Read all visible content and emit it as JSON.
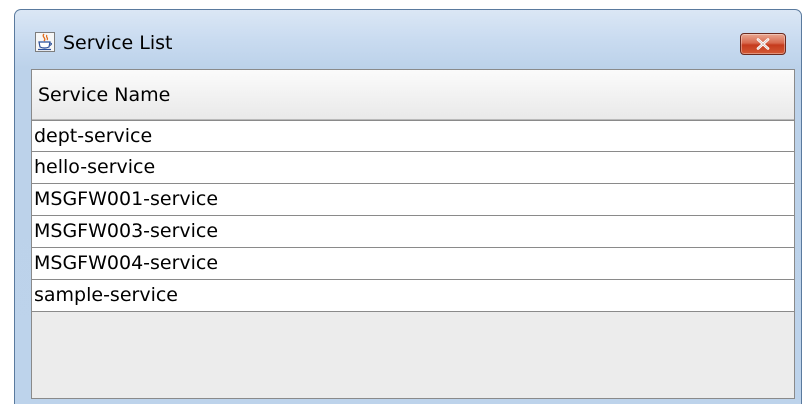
{
  "window": {
    "title": "Service List",
    "icon": "java-cup-icon",
    "close_icon": "close-icon"
  },
  "table": {
    "columns": [
      "Service Name"
    ],
    "rows": [
      "dept-service",
      "hello-service",
      "MSGFW001-service",
      "MSGFW003-service",
      "MSGFW004-service",
      "sample-service"
    ]
  },
  "colors": {
    "frame": "#bdd3eb",
    "close_button": "#c53b1d",
    "client_background": "#ececec"
  }
}
